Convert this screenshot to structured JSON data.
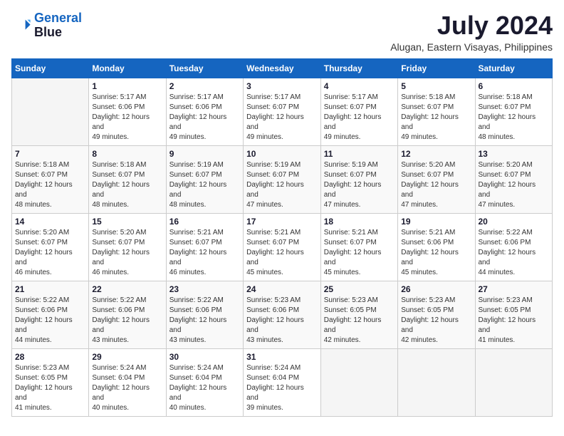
{
  "header": {
    "logo_line1": "General",
    "logo_line2": "Blue",
    "title": "July 2024",
    "subtitle": "Alugan, Eastern Visayas, Philippines"
  },
  "columns": [
    "Sunday",
    "Monday",
    "Tuesday",
    "Wednesday",
    "Thursday",
    "Friday",
    "Saturday"
  ],
  "weeks": [
    [
      {
        "day": "",
        "sunrise": "",
        "sunset": "",
        "daylight": "",
        "empty": true
      },
      {
        "day": "1",
        "sunrise": "Sunrise: 5:17 AM",
        "sunset": "Sunset: 6:06 PM",
        "daylight": "Daylight: 12 hours and 49 minutes."
      },
      {
        "day": "2",
        "sunrise": "Sunrise: 5:17 AM",
        "sunset": "Sunset: 6:06 PM",
        "daylight": "Daylight: 12 hours and 49 minutes."
      },
      {
        "day": "3",
        "sunrise": "Sunrise: 5:17 AM",
        "sunset": "Sunset: 6:07 PM",
        "daylight": "Daylight: 12 hours and 49 minutes."
      },
      {
        "day": "4",
        "sunrise": "Sunrise: 5:17 AM",
        "sunset": "Sunset: 6:07 PM",
        "daylight": "Daylight: 12 hours and 49 minutes."
      },
      {
        "day": "5",
        "sunrise": "Sunrise: 5:18 AM",
        "sunset": "Sunset: 6:07 PM",
        "daylight": "Daylight: 12 hours and 49 minutes."
      },
      {
        "day": "6",
        "sunrise": "Sunrise: 5:18 AM",
        "sunset": "Sunset: 6:07 PM",
        "daylight": "Daylight: 12 hours and 48 minutes."
      }
    ],
    [
      {
        "day": "7",
        "sunrise": "Sunrise: 5:18 AM",
        "sunset": "Sunset: 6:07 PM",
        "daylight": "Daylight: 12 hours and 48 minutes."
      },
      {
        "day": "8",
        "sunrise": "Sunrise: 5:18 AM",
        "sunset": "Sunset: 6:07 PM",
        "daylight": "Daylight: 12 hours and 48 minutes."
      },
      {
        "day": "9",
        "sunrise": "Sunrise: 5:19 AM",
        "sunset": "Sunset: 6:07 PM",
        "daylight": "Daylight: 12 hours and 48 minutes."
      },
      {
        "day": "10",
        "sunrise": "Sunrise: 5:19 AM",
        "sunset": "Sunset: 6:07 PM",
        "daylight": "Daylight: 12 hours and 47 minutes."
      },
      {
        "day": "11",
        "sunrise": "Sunrise: 5:19 AM",
        "sunset": "Sunset: 6:07 PM",
        "daylight": "Daylight: 12 hours and 47 minutes."
      },
      {
        "day": "12",
        "sunrise": "Sunrise: 5:20 AM",
        "sunset": "Sunset: 6:07 PM",
        "daylight": "Daylight: 12 hours and 47 minutes."
      },
      {
        "day": "13",
        "sunrise": "Sunrise: 5:20 AM",
        "sunset": "Sunset: 6:07 PM",
        "daylight": "Daylight: 12 hours and 47 minutes."
      }
    ],
    [
      {
        "day": "14",
        "sunrise": "Sunrise: 5:20 AM",
        "sunset": "Sunset: 6:07 PM",
        "daylight": "Daylight: 12 hours and 46 minutes."
      },
      {
        "day": "15",
        "sunrise": "Sunrise: 5:20 AM",
        "sunset": "Sunset: 6:07 PM",
        "daylight": "Daylight: 12 hours and 46 minutes."
      },
      {
        "day": "16",
        "sunrise": "Sunrise: 5:21 AM",
        "sunset": "Sunset: 6:07 PM",
        "daylight": "Daylight: 12 hours and 46 minutes."
      },
      {
        "day": "17",
        "sunrise": "Sunrise: 5:21 AM",
        "sunset": "Sunset: 6:07 PM",
        "daylight": "Daylight: 12 hours and 45 minutes."
      },
      {
        "day": "18",
        "sunrise": "Sunrise: 5:21 AM",
        "sunset": "Sunset: 6:07 PM",
        "daylight": "Daylight: 12 hours and 45 minutes."
      },
      {
        "day": "19",
        "sunrise": "Sunrise: 5:21 AM",
        "sunset": "Sunset: 6:06 PM",
        "daylight": "Daylight: 12 hours and 45 minutes."
      },
      {
        "day": "20",
        "sunrise": "Sunrise: 5:22 AM",
        "sunset": "Sunset: 6:06 PM",
        "daylight": "Daylight: 12 hours and 44 minutes."
      }
    ],
    [
      {
        "day": "21",
        "sunrise": "Sunrise: 5:22 AM",
        "sunset": "Sunset: 6:06 PM",
        "daylight": "Daylight: 12 hours and 44 minutes."
      },
      {
        "day": "22",
        "sunrise": "Sunrise: 5:22 AM",
        "sunset": "Sunset: 6:06 PM",
        "daylight": "Daylight: 12 hours and 43 minutes."
      },
      {
        "day": "23",
        "sunrise": "Sunrise: 5:22 AM",
        "sunset": "Sunset: 6:06 PM",
        "daylight": "Daylight: 12 hours and 43 minutes."
      },
      {
        "day": "24",
        "sunrise": "Sunrise: 5:23 AM",
        "sunset": "Sunset: 6:06 PM",
        "daylight": "Daylight: 12 hours and 43 minutes."
      },
      {
        "day": "25",
        "sunrise": "Sunrise: 5:23 AM",
        "sunset": "Sunset: 6:05 PM",
        "daylight": "Daylight: 12 hours and 42 minutes."
      },
      {
        "day": "26",
        "sunrise": "Sunrise: 5:23 AM",
        "sunset": "Sunset: 6:05 PM",
        "daylight": "Daylight: 12 hours and 42 minutes."
      },
      {
        "day": "27",
        "sunrise": "Sunrise: 5:23 AM",
        "sunset": "Sunset: 6:05 PM",
        "daylight": "Daylight: 12 hours and 41 minutes."
      }
    ],
    [
      {
        "day": "28",
        "sunrise": "Sunrise: 5:23 AM",
        "sunset": "Sunset: 6:05 PM",
        "daylight": "Daylight: 12 hours and 41 minutes."
      },
      {
        "day": "29",
        "sunrise": "Sunrise: 5:24 AM",
        "sunset": "Sunset: 6:04 PM",
        "daylight": "Daylight: 12 hours and 40 minutes."
      },
      {
        "day": "30",
        "sunrise": "Sunrise: 5:24 AM",
        "sunset": "Sunset: 6:04 PM",
        "daylight": "Daylight: 12 hours and 40 minutes."
      },
      {
        "day": "31",
        "sunrise": "Sunrise: 5:24 AM",
        "sunset": "Sunset: 6:04 PM",
        "daylight": "Daylight: 12 hours and 39 minutes."
      },
      {
        "day": "",
        "sunrise": "",
        "sunset": "",
        "daylight": "",
        "empty": true
      },
      {
        "day": "",
        "sunrise": "",
        "sunset": "",
        "daylight": "",
        "empty": true
      },
      {
        "day": "",
        "sunrise": "",
        "sunset": "",
        "daylight": "",
        "empty": true
      }
    ]
  ]
}
